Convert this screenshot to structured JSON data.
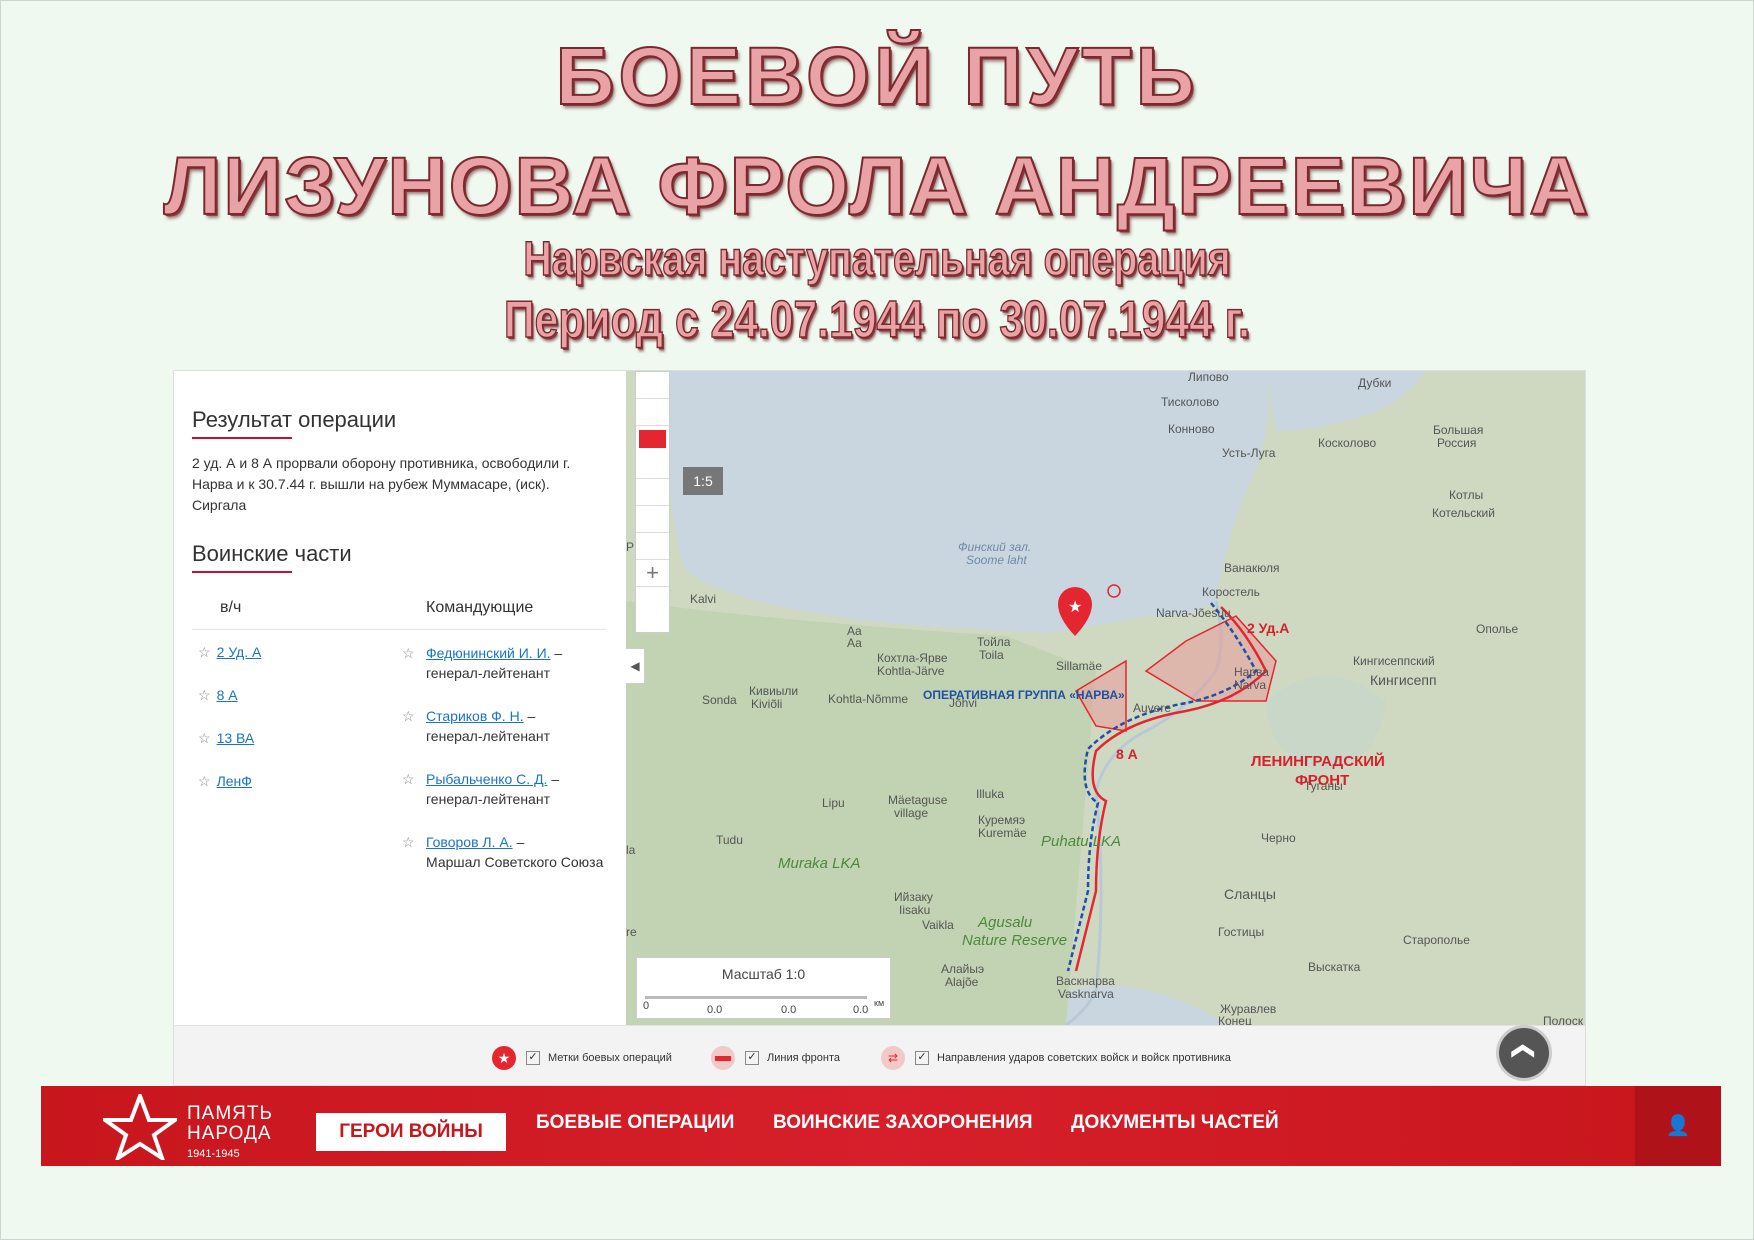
{
  "heading": {
    "line1": "БОЕВОЙ ПУТЬ",
    "line2": "ЛИЗУНОВА ФРОЛА АНДРЕЕВИЧА",
    "line3": "Нарвская наступательная операция",
    "line4": "Период с 24.07.1944 по 30.07.1944 г."
  },
  "result": {
    "title": "Результат операции",
    "text": "2 уд. А и 8 А прорвали оборону противника, освободили г. Нарва и к 30.7.44 г. вышли на рубеж Муммасаре, (иск). Сиргала"
  },
  "units": {
    "title": "Воинские части",
    "col_unit": "в/ч",
    "col_commanders": "Командующие",
    "items": [
      "2 Уд. А",
      "8 А",
      "13 ВА",
      "ЛенФ"
    ],
    "commanders": [
      {
        "name": "Федюнинский И. И.",
        "rank": "генерал-лейтенант"
      },
      {
        "name": "Стариков Ф. Н.",
        "rank": "генерал-лейтенант"
      },
      {
        "name": "Рыбальченко С. Д.",
        "rank": "генерал-лейтенант"
      },
      {
        "name": "Говоров Л. А.",
        "rank": "Маршал Советского Союза"
      }
    ]
  },
  "map": {
    "scale_badge": "1:5",
    "scale_title": "Масштаб 1:0",
    "scale_ticks": [
      "0",
      "0.0",
      "0.0",
      "0.0"
    ],
    "scale_unit": "км",
    "labels": {
      "lipovo": "Липово",
      "dubki": "Дубки",
      "tiskolovo": "Тисколово",
      "konnovo": "Конново",
      "bolshaya": "Большая",
      "rossiya": "Россия",
      "ust_luga": "Усть-Луга",
      "koskolovo": "Косколово",
      "kotly": "Котлы",
      "kotelsky": "Котельский",
      "gulf1": "Финский зал.",
      "gulf2": "Soome laht",
      "vanakyulya": "Ванакюля",
      "korostel": "Коростель",
      "narva_joesuu": "Narva-Jõesuu",
      "kalvi": "Kalvi",
      "opolye": "Ополье",
      "kingiseppsky": "Кингисеппский",
      "kingisepp": "Кингисепп",
      "aa1": "Aa",
      "aa2": "Аа",
      "kohtla_jarve1": "Кохтла-Ярве",
      "kohtla_jarve2": "Kohtla-Järve",
      "toila1": "Тойла",
      "toila2": "Toila",
      "sillamae": "Sillamäe",
      "narva1": "Нарва",
      "narva2": "Narva",
      "kiviyli1": "Кивиыли",
      "kiviyli2": "Kiviõli",
      "sonda": "Sonda",
      "kohtla_nomme": "Kohtla-Nõmme",
      "johvi": "Jõhvi",
      "auvere": "Auvere",
      "lipu": "Lipu",
      "maetaguse1": "Mäetaguse",
      "maetaguse2": "village",
      "illuka": "Illuka",
      "kuremae1": "Куремяэ",
      "kuremae2": "Kuremäe",
      "tuganу": "Туганы",
      "tudu": "Tudu",
      "muraka": "Muraka LKA",
      "puhatu": "Puhatu LKA",
      "chernoe": "Черно",
      "slantsy": "Сланцы",
      "iisaku1": "Ийзаку",
      "iisaku2": "Iisaku",
      "vaikla": "Vaikla",
      "agusalu1": "Agusalu",
      "agusalu2": "Nature Reserve",
      "gostitsy": "Гостицы",
      "staropolye": "Старополье",
      "alajoe1": "Алайыэ",
      "alajoe2": "Alajõe",
      "vasknarva1": "Васкнарва",
      "vasknarva2": "Vasknarva",
      "vyskatka": "Выскатка",
      "zhuravlevo": "Журавлев",
      "konets": "Конец",
      "polosk": "Полоск",
      "p": "P",
      "la": "la",
      "re": "re"
    },
    "army_2": "2 Уд.А",
    "army_8": "8 А",
    "front1": "ЛЕНИНГРАДСКИЙ",
    "front2": "ФРОНТ",
    "group": "ОПЕРАТИВНАЯ ГРУППА «НАРВА»"
  },
  "legend": {
    "marks": "Метки боевых операций",
    "front_line": "Линия фронта",
    "directions": "Направления ударов советских войск и войск противника",
    "check": "✓"
  },
  "nav": {
    "logo_line1": "ПАМЯТЬ",
    "logo_line2": "НАРОДА",
    "logo_years": "1941-1945",
    "items": [
      "ГЕРОИ ВОЙНЫ",
      "БОЕВЫЕ ОПЕРАЦИИ",
      "ВОИНСКИЕ ЗАХОРОНЕНИЯ",
      "ДОКУМЕНТЫ ЧАСТЕЙ"
    ],
    "user_icon": "👤",
    "up_icon": "❮"
  },
  "colors": {
    "brand_red": "#d61f2a",
    "link_blue": "#1a73c9",
    "front_red": "#e3262f",
    "soviet_blue": "#1f4fa6"
  }
}
